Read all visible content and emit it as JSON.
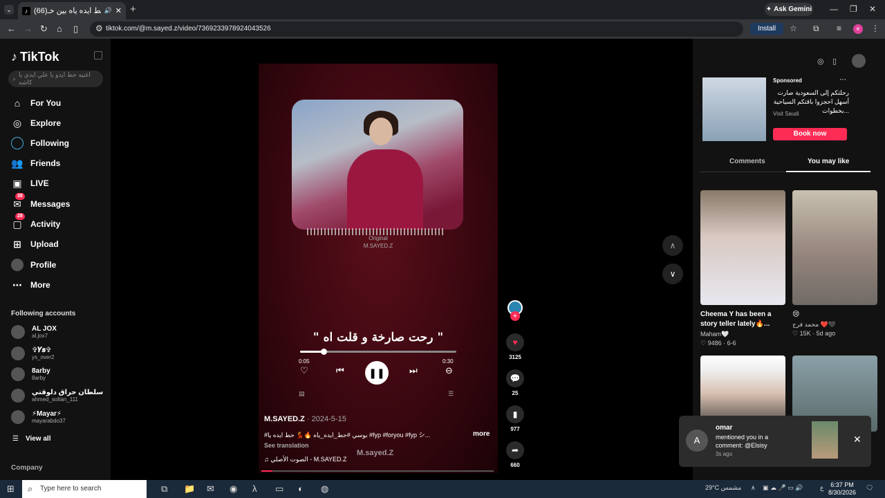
{
  "browser": {
    "tab_title": "(66)بوسي حط ايده ياه بين خـ...",
    "url": "tiktok.com/@m.sayed.z/video/7369233978924043526",
    "gemini_label": "Ask Gemini",
    "install_label": "Install",
    "profile_initial": "e"
  },
  "sidebar": {
    "logo": "TikTok",
    "search_placeholder": "اغنيه حط ايدو يا علي ايدي يا كاشه",
    "nav": [
      {
        "label": "For You",
        "icon": "home-icon"
      },
      {
        "label": "Explore",
        "icon": "compass-icon"
      },
      {
        "label": "Following",
        "icon": "following-icon"
      },
      {
        "label": "Friends",
        "icon": "friends-icon"
      },
      {
        "label": "LIVE",
        "icon": "live-icon"
      },
      {
        "label": "Messages",
        "icon": "messages-icon",
        "badge": "38"
      },
      {
        "label": "Activity",
        "icon": "activity-icon",
        "badge": "28"
      },
      {
        "label": "Upload",
        "icon": "upload-icon"
      },
      {
        "label": "Profile",
        "icon": "profile-icon"
      },
      {
        "label": "More",
        "icon": "more-icon"
      }
    ],
    "following_title": "Following accounts",
    "accounts": [
      {
        "name": "AL JOX",
        "handle": "al.jox7"
      },
      {
        "name": "✞𝒀𝒔✞",
        "handle": "ys_over2"
      },
      {
        "name": "8arby",
        "handle": "8arby"
      },
      {
        "name": "سلطان حراق دلوقتي",
        "handle": "ahmed_soltan_111"
      },
      {
        "name": "⚡Mayar⚡",
        "handle": "mayarabdo37"
      }
    ],
    "view_all": "View all",
    "company": "Company"
  },
  "video": {
    "original_label": "Original",
    "original_author": "M.SAYED.Z",
    "lyric": "\" رحت صارخة و قلت اه \"",
    "time_current": "0:05",
    "time_total": "0:30",
    "progress": 0.15,
    "author": "M.SAYED.Z",
    "date": "· 2024-5-15",
    "description": "#بوسي #حط_ايده_ياه 🔥💃 حط ايده يا #fyp #foryou #fyp シ...",
    "more": "more",
    "see_translation": "See translation",
    "sound": "♫ الصوت الأصلي - M.SAYED.Z",
    "watermark": "M.sayed.Z",
    "likes": "3125",
    "comments": "25",
    "saves": "977",
    "shares": "660"
  },
  "right": {
    "sponsored": "Sponsored",
    "ad_text": "رحلتكم إلى السعودية صارت أسهل احجزوا باقتكم السياحية بخطوات...",
    "ad_source": "Visit Saudi",
    "book_now": "Book now",
    "tabs": [
      "Comments",
      "You may like"
    ],
    "cards": [
      {
        "caption": "Cheema Y has been a story teller lately🔥...",
        "user": "Maham🤍",
        "meta": "♡ 9486 · 6-6"
      },
      {
        "caption": "😢",
        "user": "محمد فرج ❤️🖤",
        "meta": "♡ 15K · 5d ago"
      }
    ]
  },
  "toast": {
    "initial": "A",
    "who": "omar",
    "message": "mentioned you in a comment: @Elsisy",
    "ago": "3s ago"
  },
  "taskbar": {
    "search_placeholder": "Type here to search",
    "weather": "29°C  مشمس",
    "lang": "ع",
    "time": "6:37 PM",
    "date": "8/30/2026",
    "notif_count": "2"
  }
}
